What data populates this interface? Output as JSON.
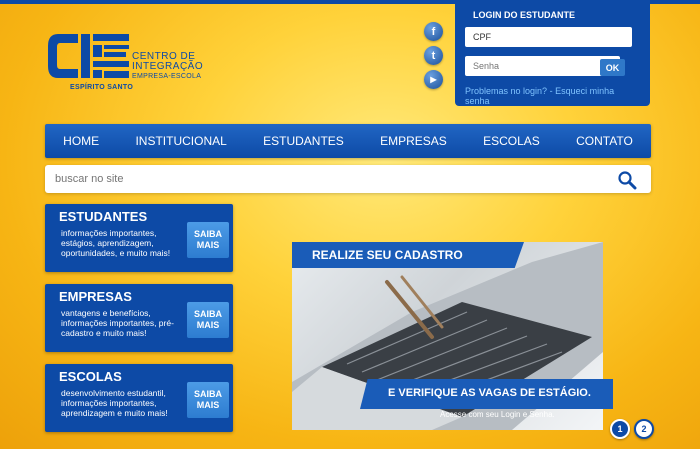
{
  "brand": {
    "line1": "CENTRO DE",
    "line2": "INTEGRAÇÃO",
    "line3": "EMPRESA-ESCOLA",
    "state": "ESPÍRITO SANTO",
    "primary_color": "#0d4aa6"
  },
  "social": [
    {
      "icon": "facebook-icon",
      "glyph": "f"
    },
    {
      "icon": "twitter-icon",
      "glyph": "t"
    },
    {
      "icon": "youtube-icon",
      "glyph": "▶"
    }
  ],
  "login": {
    "title": "LOGIN DO ESTUDANTE",
    "cpf_value": "CPF",
    "password_placeholder": "Senha",
    "ok_label": "OK",
    "problems_link": "Problemas no login?",
    "separator": " - ",
    "forgot_link": "Esqueci minha senha"
  },
  "nav": {
    "items": [
      "HOME",
      "INSTITUCIONAL",
      "ESTUDANTES",
      "EMPRESAS",
      "ESCOLAS",
      "CONTATO"
    ]
  },
  "search": {
    "placeholder": "buscar no site",
    "icon": "search-icon"
  },
  "cards": [
    {
      "title": "ESTUDANTES",
      "desc": "informações importantes, estágios, aprendizagem, oportunidades, e muito mais!",
      "button": "SAIBA MAIS"
    },
    {
      "title": "EMPRESAS",
      "desc": "vantagens e benefícios, informações importantes, pré-cadastro e muito mais!",
      "button": "SAIBA MAIS"
    },
    {
      "title": "ESCOLAS",
      "desc": "desenvolvimento estudantil, informações importantes, aprendizagem e muito mais!",
      "button": "SAIBA MAIS"
    }
  ],
  "banner": {
    "top_text": "REALIZE SEU CADASTRO",
    "bottom_text": "E VERIFIQUE AS VAGAS DE ESTÁGIO.",
    "sub_text": "Acesse com seu Login e Senha.",
    "pages": [
      "1",
      "2"
    ],
    "active_page": "1"
  }
}
